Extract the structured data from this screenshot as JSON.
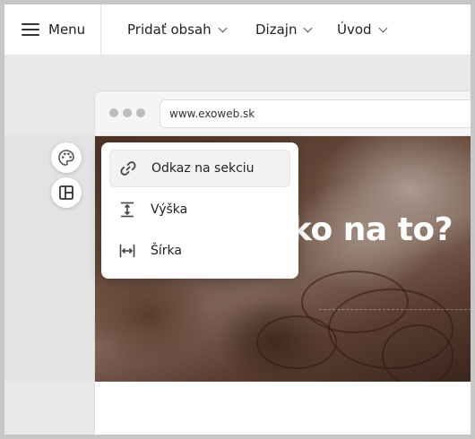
{
  "toolbar": {
    "menu_label": "Menu",
    "nav": [
      {
        "label": "Pridať obsah"
      },
      {
        "label": "Dizajn"
      },
      {
        "label": "Úvod"
      }
    ]
  },
  "browser": {
    "url": "www.exoweb.sk"
  },
  "hero": {
    "title": "ko na to?"
  },
  "popup": {
    "items": [
      {
        "label": "Odkaz na sekciu",
        "icon": "link-icon",
        "active": true
      },
      {
        "label": "Výška",
        "icon": "height-icon",
        "active": false
      },
      {
        "label": "Šírka",
        "icon": "width-icon",
        "active": false
      }
    ]
  },
  "side_buttons": [
    {
      "icon": "palette-icon"
    },
    {
      "icon": "layout-icon"
    }
  ]
}
